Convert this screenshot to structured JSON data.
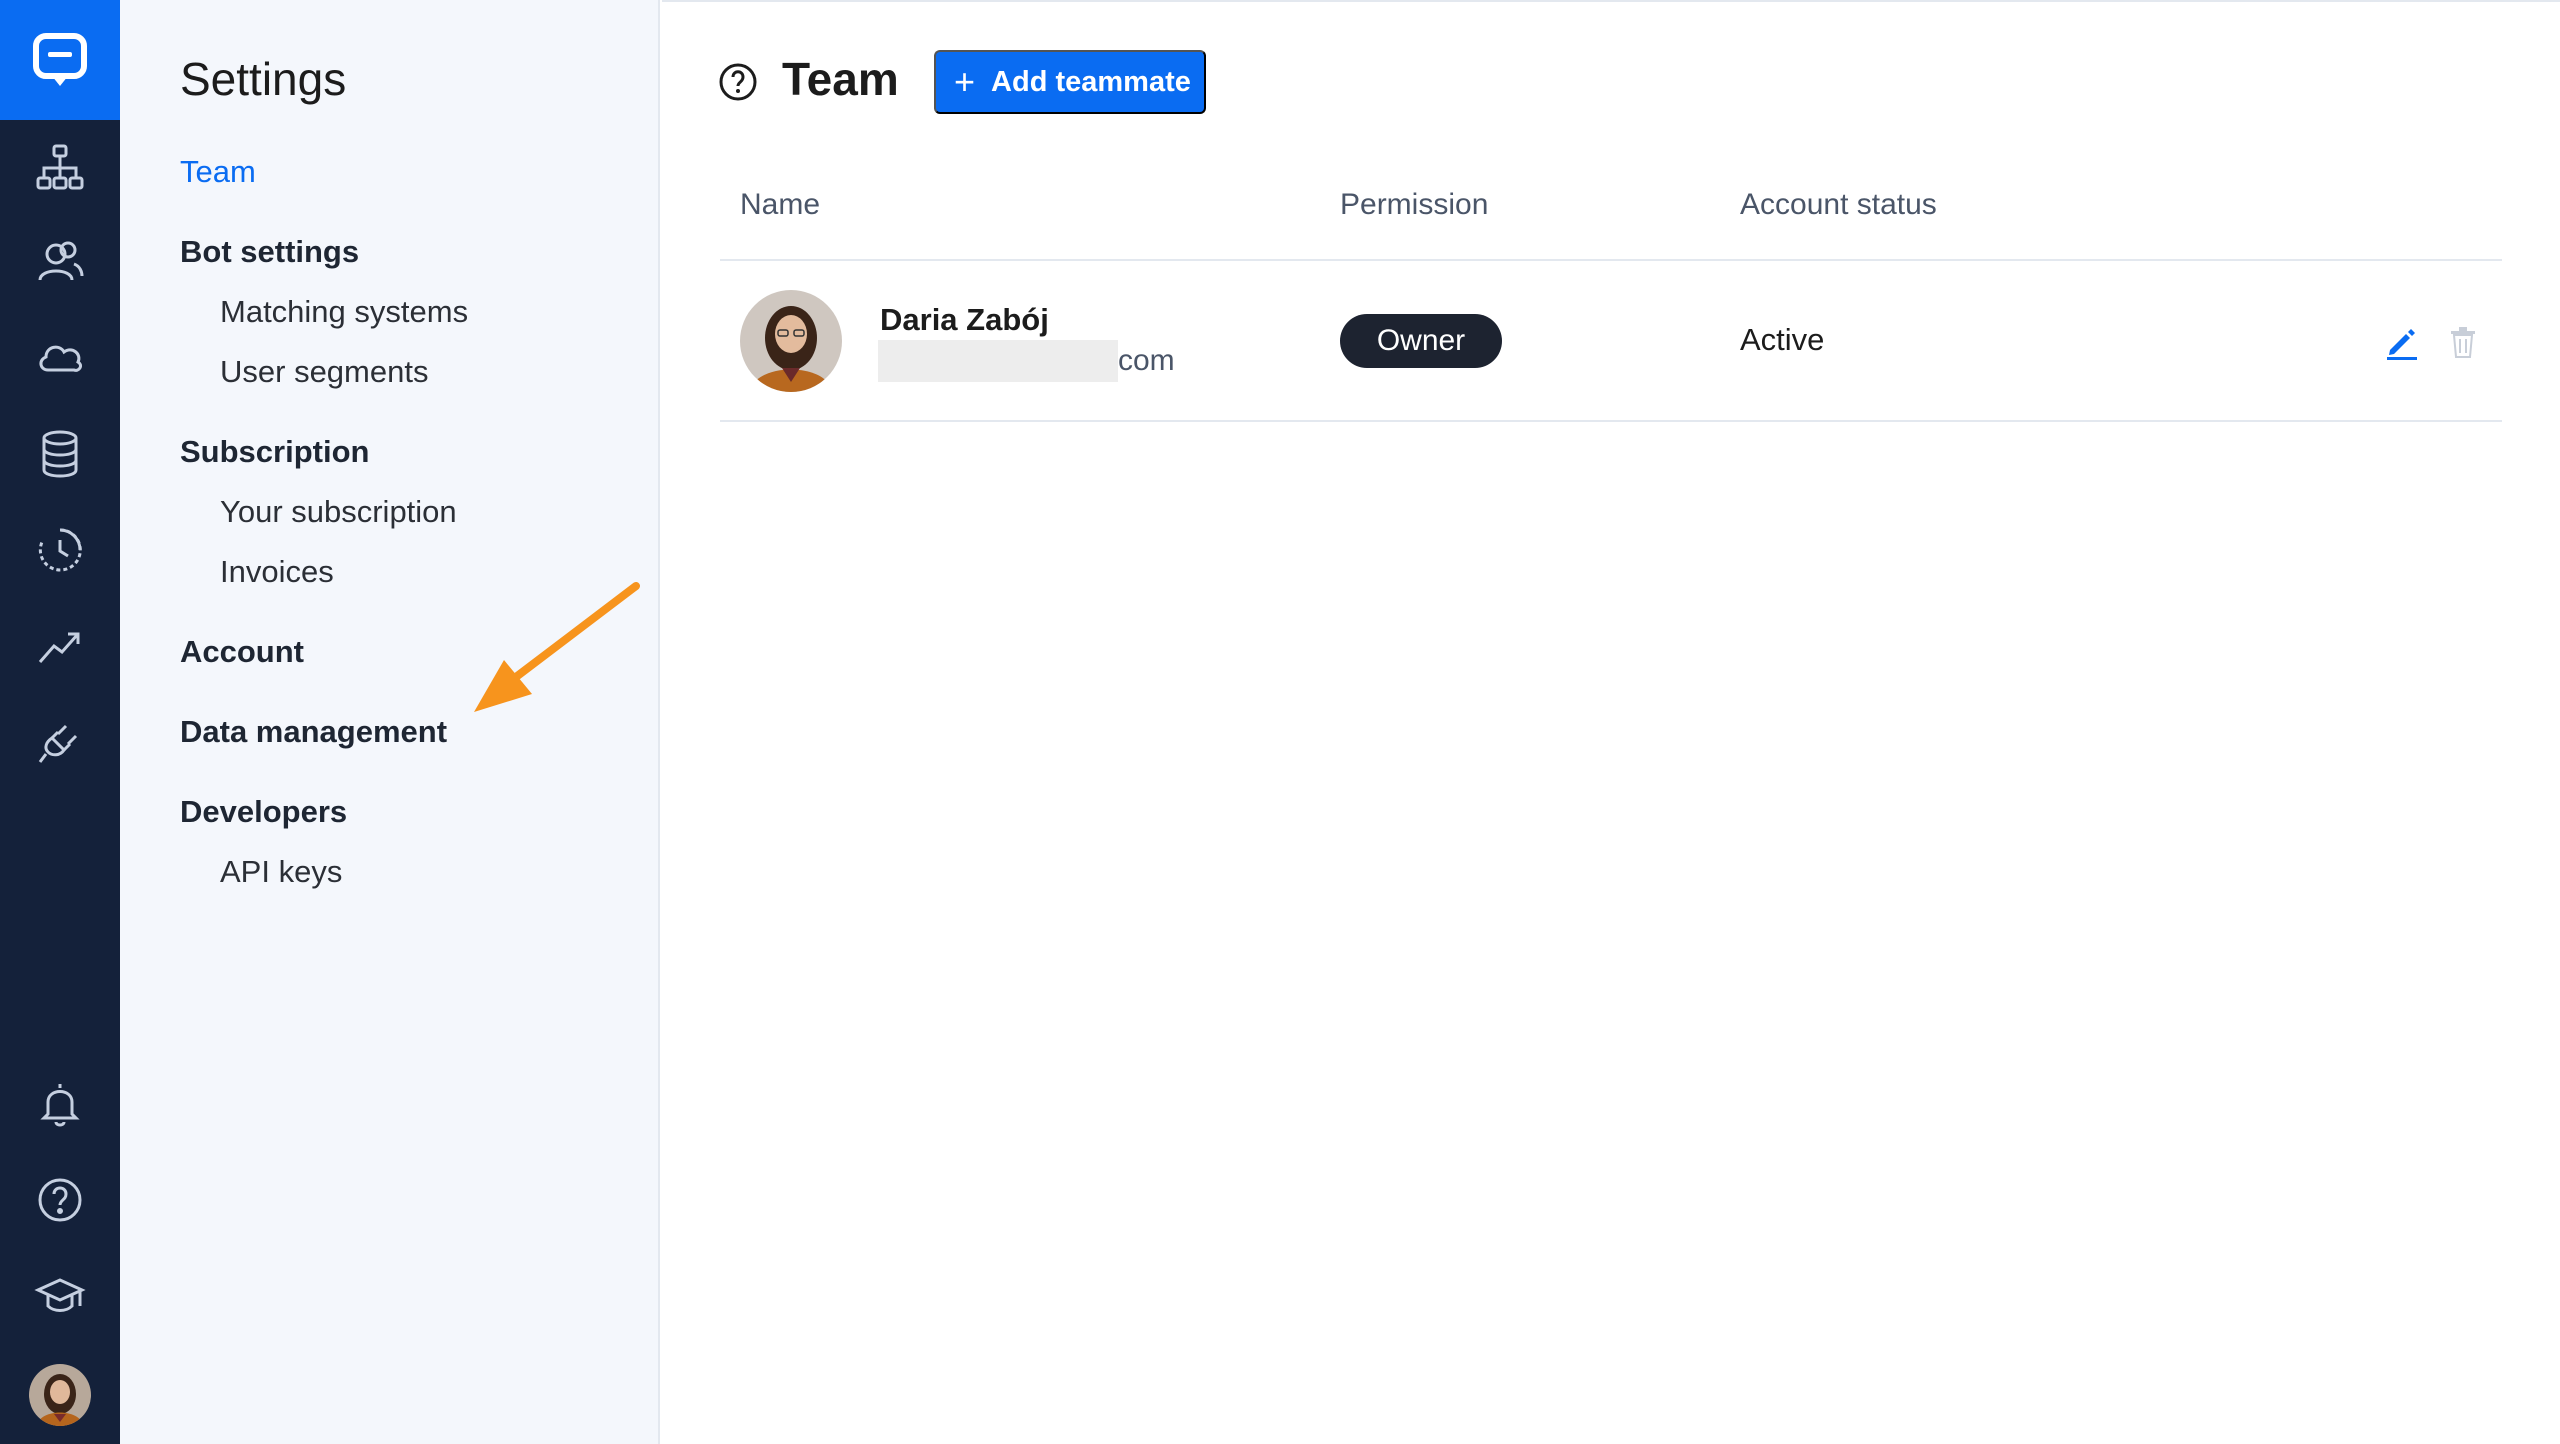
{
  "settings": {
    "title": "Settings",
    "nav": {
      "team": "Team",
      "bot_settings": "Bot settings",
      "matching_systems": "Matching systems",
      "user_segments": "User segments",
      "subscription": "Subscription",
      "your_subscription": "Your subscription",
      "invoices": "Invoices",
      "account": "Account",
      "data_management": "Data management",
      "developers": "Developers",
      "api_keys": "API keys"
    }
  },
  "rail": {
    "icons": [
      "chat-logo-icon",
      "flow-icon",
      "users-icon",
      "cloud-icon",
      "database-icon",
      "history-icon",
      "analytics-icon",
      "integrations-icon",
      "bell-icon",
      "help-icon",
      "academy-icon"
    ]
  },
  "main": {
    "title": "Team",
    "add_button": "Add teammate",
    "columns": {
      "name": "Name",
      "permission": "Permission",
      "status": "Account status"
    },
    "rows": [
      {
        "name": "Daria Zabój",
        "email_suffix": "com",
        "permission": "Owner",
        "status": "Active"
      }
    ]
  },
  "colors": {
    "accent": "#0a6cf2",
    "rail": "#14213a",
    "sidebar": "#f4f7fc",
    "arrow": "#f7941d"
  }
}
